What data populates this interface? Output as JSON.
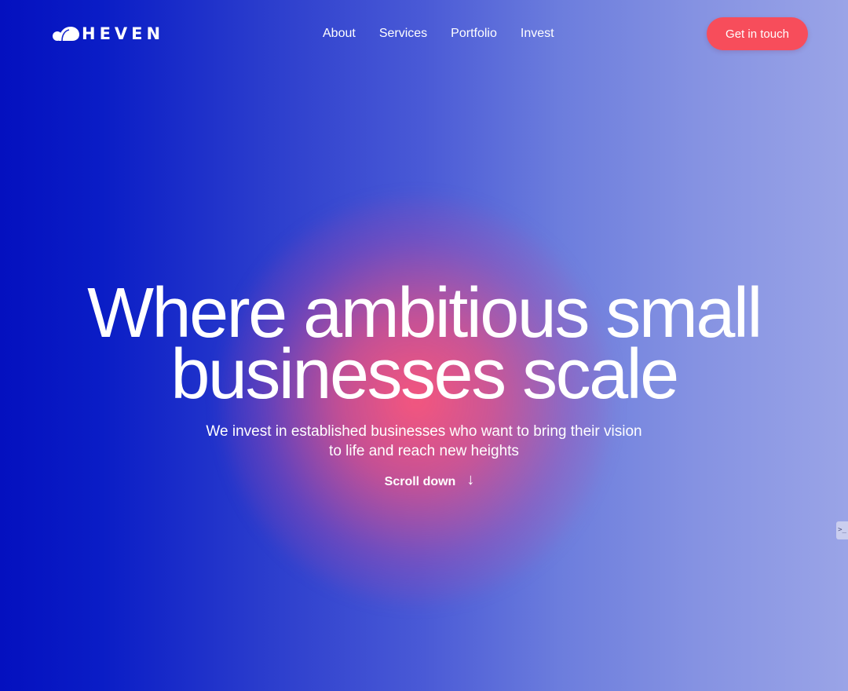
{
  "brand": {
    "name": "HEVEN",
    "logo_icon": "cloud-logo-icon"
  },
  "nav": {
    "items": [
      {
        "label": "About"
      },
      {
        "label": "Services"
      },
      {
        "label": "Portfolio"
      },
      {
        "label": "Invest"
      }
    ]
  },
  "header": {
    "cta_label": "Get in touch"
  },
  "hero": {
    "title_line1": "Where ambitious small",
    "title_line2": "businesses scale",
    "subtitle_line1": "We invest in established businesses who want to bring their vision",
    "subtitle_line2": "to life and reach new heights",
    "scroll_label": "Scroll down",
    "scroll_icon": "arrow-down-icon"
  },
  "side_tab": {
    "label": ">_",
    "icon": "terminal-icon"
  },
  "colors": {
    "background_left": "#0410bf",
    "background_right": "#9aa4e7",
    "glow": "#ff5678",
    "cta": "#f74d5b",
    "text": "#ffffff"
  }
}
